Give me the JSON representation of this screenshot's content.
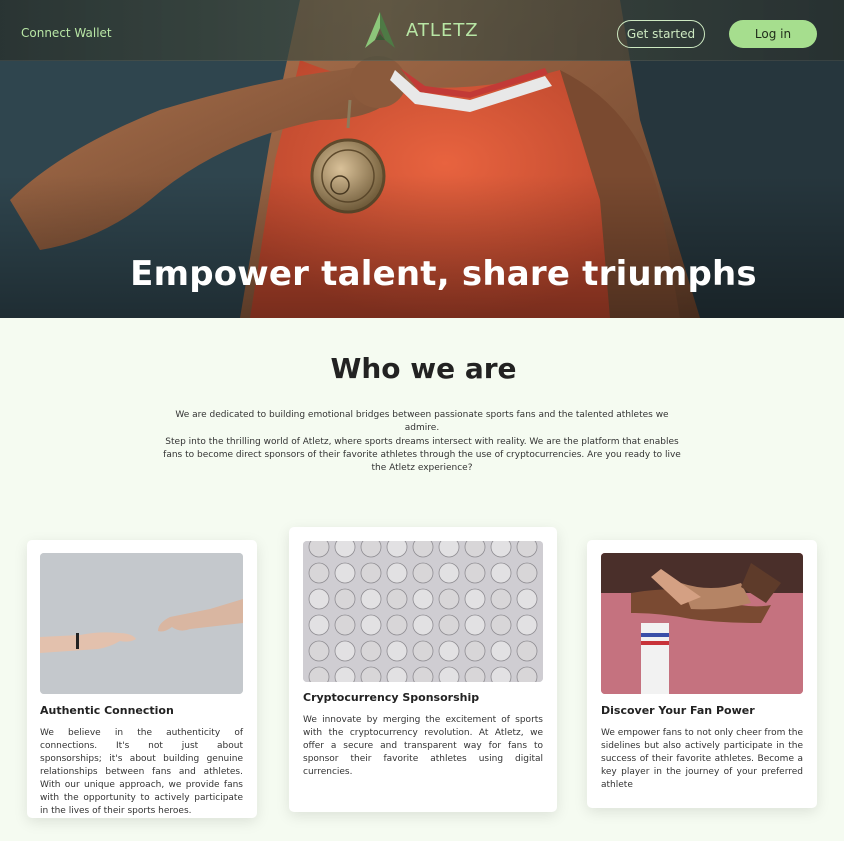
{
  "nav": {
    "connect_wallet": "Connect Wallet",
    "brand": "ATLETZ",
    "get_started": "Get started",
    "login": "Log in"
  },
  "hero": {
    "title": "Empower talent, share triumphs"
  },
  "about": {
    "title": "Who we are",
    "paragraph1": "We are dedicated to building emotional bridges between passionate sports fans and the talented athletes we admire.",
    "paragraph2": "Step into the thrilling world of Atletz, where sports dreams intersect with reality. We are the platform that enables fans to become direct sponsors of their favorite athletes through the use of cryptocurrencies. Are you ready to live the Atletz experience?"
  },
  "cards": [
    {
      "title": "Authentic Connection",
      "text": "We believe in the authenticity of connections. It's not just about sponsorships; it's about building genuine relationships between fans and athletes. With our unique approach, we provide fans with the opportunity to actively participate in the lives of their sports heroes.",
      "image": "reaching-hands-photo"
    },
    {
      "title": "Cryptocurrency Sponsorship",
      "text": "We innovate by merging the excitement of sports with the cryptocurrency revolution. At Atletz, we offer a secure and transparent way for fans to sponsor their favorite athletes using digital currencies.",
      "image": "crypto-coins-photo"
    },
    {
      "title": "Discover Your Fan Power",
      "text": "We empower fans to not only cheer from the sidelines but also actively participate in the success of their favorite athletes. Become a key player in the journey of your preferred athlete",
      "image": "team-hands-photo"
    }
  ],
  "colors": {
    "accent": "#a6de8e",
    "accent_text": "#b8e6a5",
    "page_bg": "#f5fbf1",
    "jersey": "#d9563a"
  }
}
